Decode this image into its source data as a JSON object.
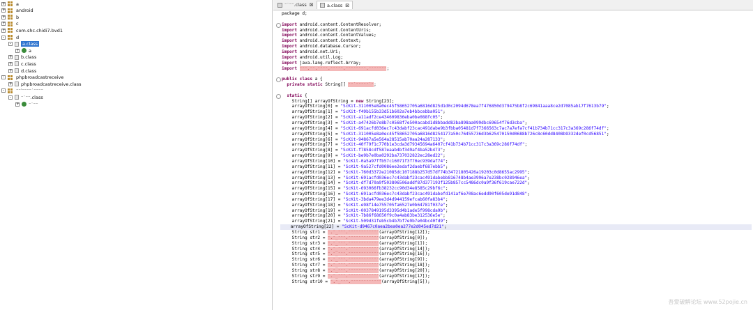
{
  "tree": [
    {
      "label": "a",
      "toggle": "+",
      "icon": "package-icon",
      "indent": 0
    },
    {
      "label": "android",
      "toggle": "+",
      "icon": "package-icon",
      "indent": 0
    },
    {
      "label": "b",
      "toggle": "+",
      "icon": "package-icon",
      "indent": 0
    },
    {
      "label": "c",
      "toggle": "+",
      "icon": "package-icon",
      "indent": 0
    },
    {
      "label": "com.shc.chidi7.bvd1",
      "toggle": "+",
      "icon": "package-icon",
      "indent": 0
    },
    {
      "label": "d",
      "toggle": "-",
      "icon": "package-icon",
      "indent": 0
    },
    {
      "label": "a.class",
      "toggle": "-",
      "icon": "file-icon",
      "indent": 1,
      "selected": true
    },
    {
      "label": "a",
      "toggle": "+",
      "icon": "class-icon",
      "indent": 2
    },
    {
      "label": "b.class",
      "toggle": "+",
      "icon": "file-icon",
      "indent": 1
    },
    {
      "label": "c.class",
      "toggle": "+",
      "icon": "file-icon",
      "indent": 1
    },
    {
      "label": "d.class",
      "toggle": "+",
      "icon": "file-icon",
      "indent": 1
    },
    {
      "label": "phpbroadcastreceive",
      "toggle": "-",
      "icon": "package-icon",
      "indent": 0
    },
    {
      "label": "phpbroadcastreceive.class",
      "toggle": "+",
      "icon": "file-icon",
      "indent": 1
    },
    {
      "label": "⁻⁻‵⁻⁻⁻⁻˙⁻⁻⁻⁻",
      "toggle": "-",
      "icon": "package-icon",
      "indent": 0
    },
    {
      "label": "⁻˙⁻⁻.class",
      "toggle": "-",
      "icon": "file-icon",
      "indent": 1
    },
    {
      "label": "⁻˙⁻⁻",
      "toggle": "+",
      "icon": "class-icon",
      "indent": 2
    }
  ],
  "tabs": [
    {
      "label": "⁻˙⁻⁻.class",
      "close": "⊠"
    },
    {
      "label": "a.class",
      "close": "⊠"
    }
  ],
  "watermark": "吾爱破解论坛 www.52pojie.cn",
  "code": [
    [
      {
        "t": "package d;"
      }
    ],
    [],
    [
      {
        "t": "import",
        "c": "kw"
      },
      {
        "t": " android.content.ContentResolver;"
      }
    ],
    [
      {
        "t": "import",
        "c": "kw"
      },
      {
        "t": " android.content.ContentUris;"
      }
    ],
    [
      {
        "t": "import",
        "c": "kw"
      },
      {
        "t": " android.content.ContentValues;"
      }
    ],
    [
      {
        "t": "import",
        "c": "kw"
      },
      {
        "t": " android.content.Context;"
      }
    ],
    [
      {
        "t": "import",
        "c": "kw"
      },
      {
        "t": " android.database.Cursor;"
      }
    ],
    [
      {
        "t": "import",
        "c": "kw"
      },
      {
        "t": " android.net.Uri;"
      }
    ],
    [
      {
        "t": "import",
        "c": "kw"
      },
      {
        "t": " android.util.Log;"
      }
    ],
    [
      {
        "t": "import",
        "c": "kw"
      },
      {
        "t": " java.lang.reflect.Array;"
      }
    ],
    [
      {
        "t": "import",
        "c": "kw"
      },
      {
        "t": " "
      },
      {
        "t": "⁻⁻⁻.⁻⁻.⁻⁻⁻⁻.⁻⁻⁻⁻⁻.⁻⁻⁻⁻⁻⁻⁻⁻.⁻⁻⁻⁻⁻⁻⁻",
        "c": "rd"
      },
      {
        "t": ";"
      }
    ],
    [],
    [
      {
        "t": "public class",
        "c": "kw"
      },
      {
        "t": " a {"
      }
    ],
    [
      {
        "t": "  "
      },
      {
        "t": "private static",
        "c": "kw"
      },
      {
        "t": " String[] "
      },
      {
        "t": "⁻⁻˙⁻⁻⁻⁻⁻˙⁻",
        "c": "rd"
      },
      {
        "t": ";"
      }
    ],
    [],
    [
      {
        "t": "  "
      },
      {
        "t": "static",
        "c": "kw"
      },
      {
        "t": " {"
      }
    ],
    [
      {
        "t": "    String[] arrayOfString = "
      },
      {
        "t": "new",
        "c": "kw"
      },
      {
        "t": " String[23];"
      }
    ],
    [
      {
        "t": "    arrayOfString[0] = "
      },
      {
        "t": "\"ScKit-311005e8a0ec45f58652705a6816d825d1d0c2094d678ea7f476850d379475b8f2c69841aaa8ce2d7085ab17f7613b79\"",
        "c": "st"
      },
      {
        "t": ";"
      }
    ],
    [
      {
        "t": "    arrayOfString[1] = "
      },
      {
        "t": "\"ScKit-f49b155b33d51b602a7eb4bbcebba051\"",
        "c": "st"
      },
      {
        "t": ";"
      }
    ],
    [
      {
        "t": "    arrayOfString[2] = "
      },
      {
        "t": "\"ScKit-a11adf2ce434609836eba0be088fc05\"",
        "c": "st"
      },
      {
        "t": ";"
      }
    ],
    [
      {
        "t": "    arrayOfString[3] = "
      },
      {
        "t": "\"ScKit-a47426b7e8b7c0568f7e500acabd1d8bbadd83ba898aa099dbc69654f76d3cba\"",
        "c": "st"
      },
      {
        "t": ";"
      }
    ],
    [
      {
        "t": "    arrayOfString[4] = "
      },
      {
        "t": "\"ScKit-691acfd036ec7c43dabf23cac491dabe9b3fbba05481d7f7366563c7ac7a7efa7cf41b734b71cc317c3a369c286f74df\"",
        "c": "st"
      },
      {
        "t": ";"
      }
    ],
    [
      {
        "t": "    arrayOfString[5] = "
      },
      {
        "t": "\"ScKit-311005e8a0ec45f58652705a6816d8254177a50c76455736d3b625470150d0688b726c8c60dd8408b9332def0cd56851\"",
        "c": "st"
      },
      {
        "t": ";"
      }
    ],
    [
      {
        "t": "    arrayOfString[6] = "
      },
      {
        "t": "\"ScKit-94867a5e564a28515ab70aa24a287133\"",
        "c": "st"
      },
      {
        "t": ";"
      }
    ],
    [
      {
        "t": "    arrayOfString[7] = "
      },
      {
        "t": "\"ScKit-40f79f1c770b1e3cda3d79345694a6407cf41b734b71cc317c3a369c286f74df\"",
        "c": "st"
      },
      {
        "t": ";"
      }
    ],
    [
      {
        "t": "    arrayOfString[8] = "
      },
      {
        "t": "\"ScKit-f7858cdf587eaab4bf349af4ba52b473\"",
        "c": "st"
      },
      {
        "t": ";"
      }
    ],
    [
      {
        "t": "    arrayOfString[9] = "
      },
      {
        "t": "\"ScKit-be9b7e0ba0292ba737032822ec28ed22\"",
        "c": "st"
      },
      {
        "t": ";"
      }
    ],
    [
      {
        "t": "    arrayOfString[10] = "
      },
      {
        "t": "\"ScKit-0a5a97ffb57c16071f3f70ec939daf74\"",
        "c": "st"
      },
      {
        "t": ";"
      }
    ],
    [
      {
        "t": "    arrayOfString[11] = "
      },
      {
        "t": "\"ScKit-9a527cfd0086ee2edaf2daebf687ebb5\"",
        "c": "st"
      },
      {
        "t": ";"
      }
    ],
    [
      {
        "t": "    arrayOfString[12] = "
      },
      {
        "t": "\"ScKit-760d3372e21085dc107188b257d57df74b34721805426a19203c0d8655ac2995\"",
        "c": "st"
      },
      {
        "t": ";"
      }
    ],
    [
      {
        "t": "    arrayOfString[13] = "
      },
      {
        "t": "\"ScKit-691acfd036ec7c43dabf23cac491dabebb816748b4ae3996a7e238bc028946ea\"",
        "c": "st"
      },
      {
        "t": ";"
      }
    ],
    [
      {
        "t": "    arrayOfString[14] = "
      },
      {
        "t": "\"ScKit-df7d70a9f503806506addf87d377193f125b857cc5486dc0a9f36f619cae722d\"",
        "c": "st"
      },
      {
        "t": ";"
      }
    ],
    [
      {
        "t": "    arrayOfString[15] = "
      },
      {
        "t": "\"ScKit-693066fb38232cc90d34e8585c29bf6c\"",
        "c": "st"
      },
      {
        "t": ";"
      }
    ],
    [
      {
        "t": "    arrayOfString[16] = "
      },
      {
        "t": "\"ScKit-691acfd036ec7c43dabf23cac491dabefd141af6e708ac6edd90f605de91d848\"",
        "c": "st"
      },
      {
        "t": ";"
      }
    ],
    [
      {
        "t": "    arrayOfString[17] = "
      },
      {
        "t": "\"ScKit-3bda479ee3d4d944159efcab60fa83b4\"",
        "c": "st"
      },
      {
        "t": ";"
      }
    ],
    [
      {
        "t": "    arrayOfString[18] = "
      },
      {
        "t": "\"ScKit-e98f14e755705fa6527e0b64781f037e\"",
        "c": "st"
      },
      {
        "t": ";"
      }
    ],
    [
      {
        "t": "    arrayOfString[19] = "
      },
      {
        "t": "\"ScKit-0037849195d3395d4b1ade5f998cda9b\"",
        "c": "st"
      },
      {
        "t": ";"
      }
    ],
    [
      {
        "t": "    arrayOfString[20] = "
      },
      {
        "t": "\"ScKit-7b86f68650f9c0a4ab83be312536e5e\"",
        "c": "st"
      },
      {
        "t": ";"
      }
    ],
    [
      {
        "t": "    arrayOfString[21] = "
      },
      {
        "t": "\"ScKit-509d31feb5cb4b7bf7e9b7e04bc40fd9\"",
        "c": "st"
      },
      {
        "t": ";"
      }
    ],
    [
      {
        "t": "    arrayOfString[22] = "
      },
      {
        "t": "\"ScKit-d9467c0aea2bea0ea277e2d045ed7d21\"",
        "c": "st"
      },
      {
        "t": ";"
      }
    ],
    [
      {
        "t": "    String str1 = "
      },
      {
        "t": "⁻.⁻_⁻⁻⁻.⁻⁻⁻⁻⁻⁻⁻⁻⁻⁻⁻⁻",
        "c": "rd"
      },
      {
        "t": "(arrayOfString[12]);"
      }
    ],
    [
      {
        "t": "    String str2 = "
      },
      {
        "t": "⁻.⁻_⁻⁻⁻.⁻⁻⁻⁻⁻⁻⁻⁻⁻⁻⁻⁻",
        "c": "rd"
      },
      {
        "t": "(arrayOfString[0]);"
      }
    ],
    [
      {
        "t": "    String str3 = "
      },
      {
        "t": "⁻.⁻_⁻⁻⁻.⁻⁻⁻⁻⁻⁻⁻⁻⁻⁻⁻⁻",
        "c": "rd"
      },
      {
        "t": "(arrayOfString[1]);"
      }
    ],
    [
      {
        "t": "    String str4 = "
      },
      {
        "t": "⁻.⁻_⁻⁻⁻.⁻⁻⁻⁻⁻⁻⁻⁻⁻⁻⁻⁻",
        "c": "rd"
      },
      {
        "t": "(arrayOfString[14]);"
      }
    ],
    [
      {
        "t": "    String str5 = "
      },
      {
        "t": "⁻.⁻_⁻⁻⁻.⁻⁻⁻⁻⁻⁻⁻⁻⁻⁻⁻⁻",
        "c": "rd"
      },
      {
        "t": "(arrayOfString[16]);"
      }
    ],
    [
      {
        "t": "    String str6 = "
      },
      {
        "t": "⁻.⁻_⁻⁻⁻.⁻⁻⁻⁻⁻⁻⁻⁻⁻⁻⁻⁻",
        "c": "rd"
      },
      {
        "t": "(arrayOfString[9]);"
      }
    ],
    [
      {
        "t": "    String str7 = "
      },
      {
        "t": "⁻.⁻_⁻⁻⁻.⁻⁻⁻⁻⁻⁻⁻⁻⁻⁻⁻⁻",
        "c": "rd"
      },
      {
        "t": "(arrayOfString[18]);"
      }
    ],
    [
      {
        "t": "    String str8 = "
      },
      {
        "t": "⁻.⁻_⁻⁻⁻.⁻⁻⁻⁻⁻⁻⁻⁻⁻⁻⁻⁻",
        "c": "rd"
      },
      {
        "t": "(arrayOfString[20]);"
      }
    ],
    [
      {
        "t": "    String str9 = "
      },
      {
        "t": "⁻.⁻_⁻⁻⁻.⁻⁻⁻⁻⁻⁻⁻⁻⁻⁻⁻⁻",
        "c": "rd"
      },
      {
        "t": "(arrayOfString[17]);"
      }
    ],
    [
      {
        "t": "    String str10 = "
      },
      {
        "t": "⁻.⁻_⁻⁻⁻.⁻⁻⁻⁻⁻⁻⁻⁻⁻⁻⁻⁻",
        "c": "rd"
      },
      {
        "t": "(arrayOfString[5]);"
      }
    ]
  ]
}
